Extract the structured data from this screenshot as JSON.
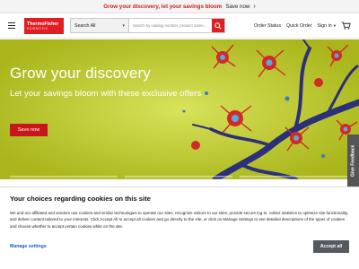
{
  "promo": {
    "text": "Grow your discovery, let your savings bloom",
    "link": "Save now"
  },
  "header": {
    "logo_line1": "ThermoFisher",
    "logo_line2": "SCIENTIFIC",
    "search_category": "Search All",
    "search_placeholder": "Search by catalog number, product name...",
    "nav": {
      "order_status": "Order Status",
      "quick_order": "Quick Order",
      "sign_in": "Sign in"
    }
  },
  "hero": {
    "title": "Grow your discovery",
    "subtitle": "Let your savings bloom with these exclusive offers",
    "button": "Save now"
  },
  "feedback_tab": "Give Feedback",
  "cookie": {
    "title": "Your choices regarding cookies on this site",
    "body": "We and our affiliated and vendors use cookies and similar technologies to operate our sites, recognize visitors to our sites, provide secure log-in, collect statistics to optimize site functionality, and deliver content tailored to your interests. Click Accept All to accept all cookies and go directly to the site, or click on Manage Settings to see detailed descriptions of the types of cookies and choose whether to accept certain cookies while on the site.",
    "manage_label": "Manage settings",
    "accept_label": "Accept all"
  },
  "colors": {
    "brand_red": "#e01e24",
    "hero_green": "#b8c422",
    "promo_red": "#cc1b1b",
    "accept_gray": "#555a60"
  },
  "icons": [
    "hamburger-icon",
    "chevron-right-icon",
    "chevron-down-icon",
    "search-icon",
    "cart-icon",
    "cell-illustration"
  ]
}
